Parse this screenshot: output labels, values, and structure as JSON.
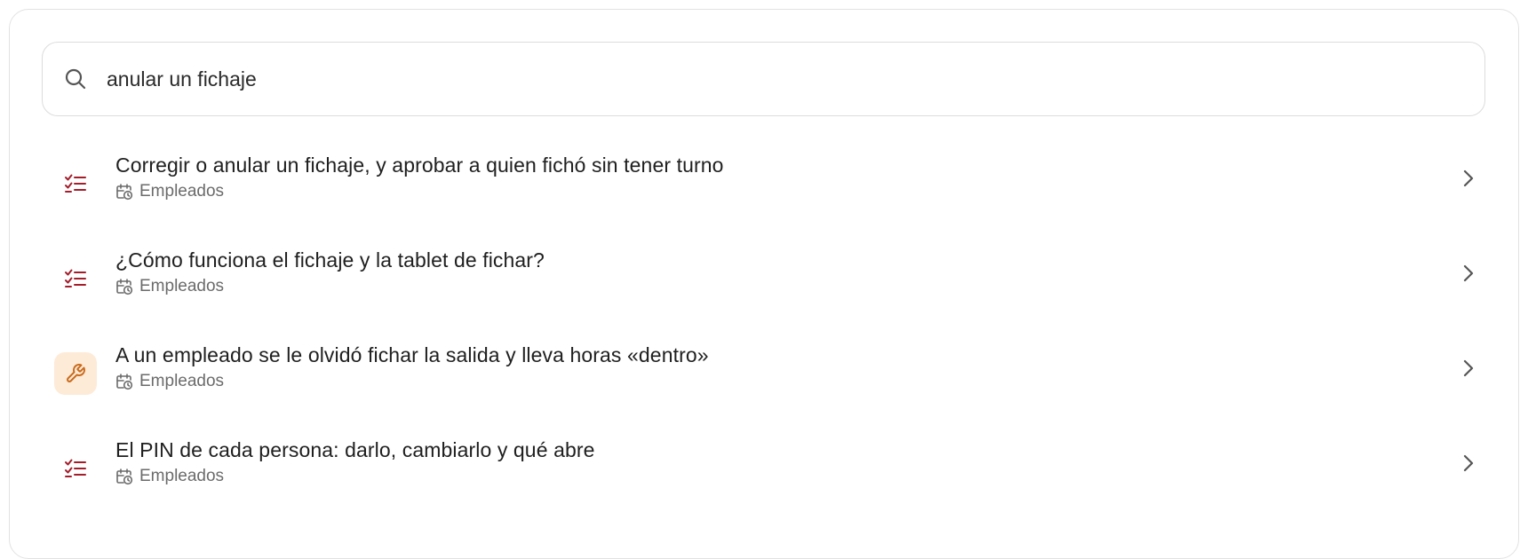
{
  "search": {
    "value": "anular un fichaje",
    "icon": "search-icon"
  },
  "colors": {
    "checklist_icon": "#a31d2b",
    "wrench_icon": "#c96a1c",
    "wrench_bg": "#fdebd7",
    "meta_text": "#6b6b6b",
    "chevron": "#555555"
  },
  "results": [
    {
      "title": "Corregir o anular un fichaje, y aprobar a quien fichó sin tener turno",
      "category": "Empleados",
      "icon": "checklist-icon",
      "highlighted": false
    },
    {
      "title": "¿Cómo funciona el fichaje y la tablet de fichar?",
      "category": "Empleados",
      "icon": "checklist-icon",
      "highlighted": false
    },
    {
      "title": "A un empleado se le olvidó fichar la salida y lleva horas «dentro»",
      "category": "Empleados",
      "icon": "wrench-icon",
      "highlighted": true
    },
    {
      "title": "El PIN de cada persona: darlo, cambiarlo y qué abre",
      "category": "Empleados",
      "icon": "checklist-icon",
      "highlighted": false
    }
  ]
}
